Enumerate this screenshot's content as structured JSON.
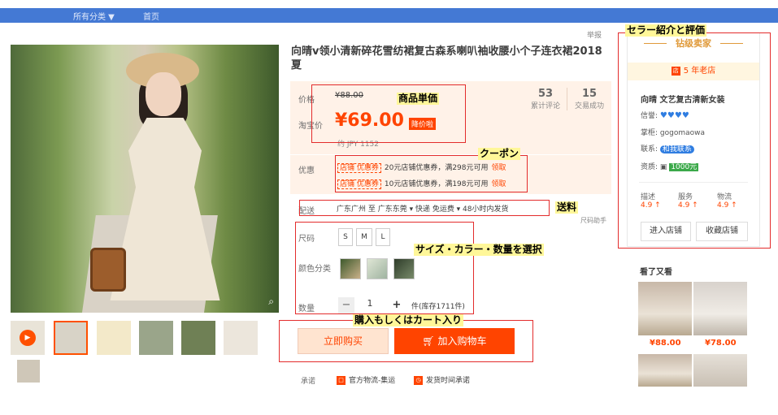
{
  "nav": {
    "category": "所有分类 ▼",
    "home": "首页"
  },
  "report": "举报",
  "product": {
    "title": "向晴v领小清新碎花雪纺裙复古森系喇叭袖收腰小个子连衣裙2018夏",
    "price_label": "价格",
    "price_original": "¥88.00",
    "taobao_label": "淘宝价",
    "price_current": "¥69.00",
    "price_tag": "降价啦",
    "price_jpy": "约 JPY 1152",
    "stats": [
      {
        "value": "53",
        "label": "累计评论"
      },
      {
        "value": "15",
        "label": "交易成功"
      }
    ]
  },
  "coupon": {
    "label": "优惠",
    "items": [
      {
        "tag": "店铺 优惠券",
        "text": "20元店铺优惠券，满298元可用",
        "claim": "领取"
      },
      {
        "tag": "店铺 优惠券",
        "text": "10元店铺优惠券，满198元可用",
        "claim": "领取"
      }
    ]
  },
  "shipping": {
    "label": "配送",
    "text": "广东广州 至  广东东莞 ▾   快递 免运费 ▾   48小时内发货",
    "help": "尺码助手"
  },
  "options": {
    "size_label": "尺码",
    "sizes": [
      "S",
      "M",
      "L"
    ],
    "color_label": "颜色分类",
    "qty_label": "数量",
    "qty_value": "1",
    "qty_minus": "−",
    "qty_plus": "+",
    "stock": "件(库存1711件)"
  },
  "actions": {
    "buy_now": "立即购买",
    "add_cart": "加入购物车",
    "cart_icon": "cart-icon"
  },
  "promise": {
    "label": "承诺",
    "items": [
      "官方物流-集运",
      "发货时间承诺"
    ]
  },
  "seller": {
    "rank": "钻级卖家",
    "years": "5 年老店",
    "shop_name": "向晴 文艺复古清新女装",
    "credit_label": "信誉:",
    "credit_hearts": "♥♥♥♥",
    "keeper_label": "掌柜:",
    "keeper": "gogomaowa",
    "contact_label": "联系:",
    "contact": "和我联系",
    "qual_label": "资质:",
    "qual_value": "1000元",
    "scores": [
      {
        "label": "描述",
        "value": "4.9 ↑"
      },
      {
        "label": "服务",
        "value": "4.9 ↑"
      },
      {
        "label": "物流",
        "value": "4.9 ↑"
      }
    ],
    "enter_shop": "进入店铺",
    "fav_shop": "收藏店铺"
  },
  "also_viewed": {
    "title": "看了又看",
    "items": [
      {
        "price": "¥88.00"
      },
      {
        "price": "¥78.00"
      }
    ]
  },
  "annotations": {
    "unit_price": "商品単価",
    "coupon": "クーポン",
    "shipping": "送料",
    "select": "サイズ・カラー・数量を選択",
    "buy": "購入もしくはカート入り",
    "seller": "セラー紹介と評価"
  },
  "colors": {
    "accent": "#ff4400",
    "topbar": "#4479d4",
    "annotation_border": "#e32c2c",
    "annotation_bg": "#fff799"
  }
}
